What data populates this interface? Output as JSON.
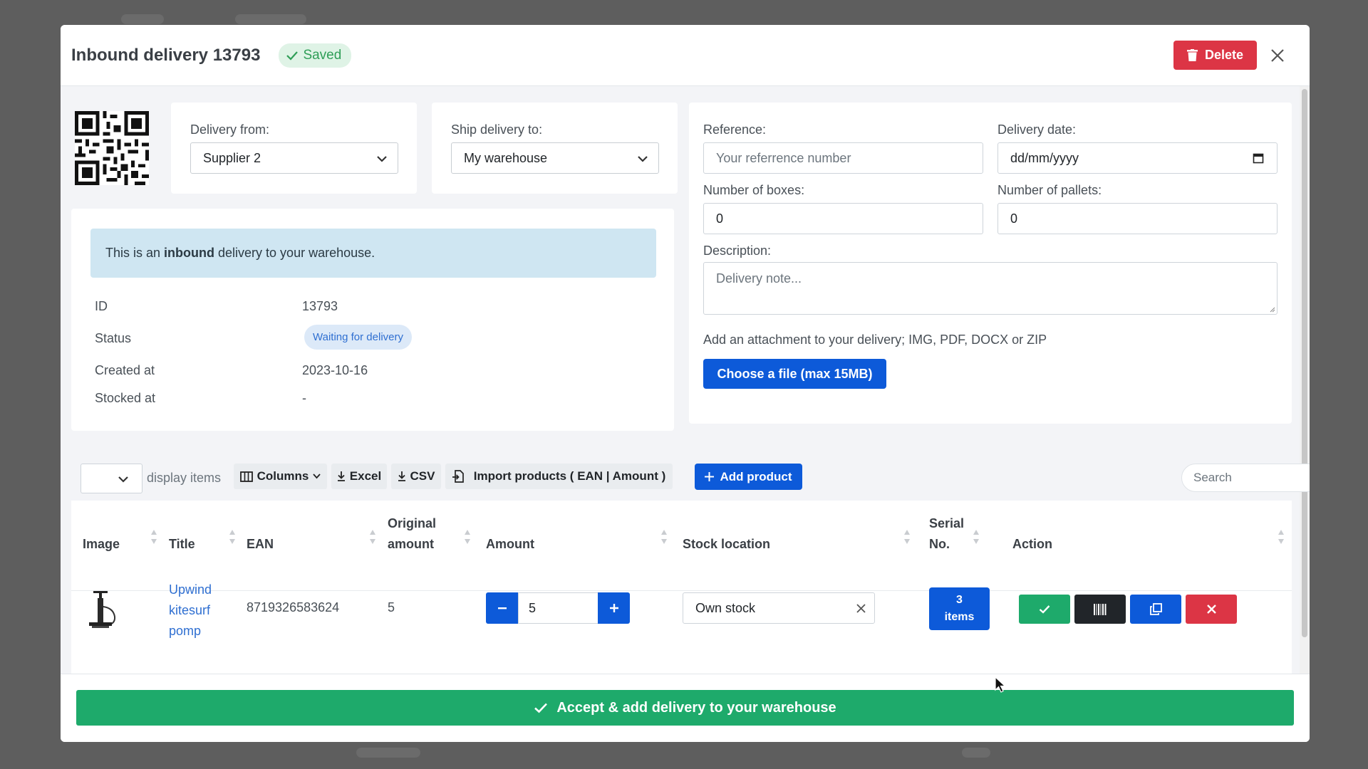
{
  "modal": {
    "title": "Inbound delivery 13793",
    "saved_label": "Saved",
    "delete_label": "Delete"
  },
  "form": {
    "delivery_from_label": "Delivery from:",
    "delivery_from_value": "Supplier 2",
    "ship_to_label": "Ship delivery to:",
    "ship_to_value": "My warehouse",
    "reference_label": "Reference:",
    "reference_placeholder": "Your referrence number",
    "delivery_date_label": "Delivery date:",
    "delivery_date_placeholder": "dd/mm/yyyy",
    "boxes_label": "Number of boxes:",
    "boxes_value": "0",
    "pallets_label": "Number of pallets:",
    "pallets_value": "0",
    "description_label": "Description:",
    "description_placeholder": "Delivery note...",
    "attachment_hint": "Add an attachment to your delivery; IMG, PDF, DOCX or ZIP",
    "choose_file_label": "Choose a file (max 15MB)"
  },
  "info": {
    "alert_prefix": "This is an ",
    "alert_bold": "inbound",
    "alert_suffix": " delivery to your warehouse.",
    "rows": [
      {
        "label": "ID",
        "value": "13793"
      },
      {
        "label": "Status",
        "value": "Waiting for delivery"
      },
      {
        "label": "Created at",
        "value": "2023-10-16"
      },
      {
        "label": "Stocked at",
        "value": "-"
      }
    ]
  },
  "toolbar": {
    "display_items_label": "display items",
    "columns_label": "Columns",
    "excel_label": "Excel",
    "csv_label": "CSV",
    "import_label": "Import products ( EAN | Amount )",
    "add_product_label": "Add product",
    "search_placeholder": "Search"
  },
  "table": {
    "headers": {
      "image": "Image",
      "title": "Title",
      "ean": "EAN",
      "original_amount_1": "Original",
      "original_amount_2": "amount",
      "amount": "Amount",
      "stock_location": "Stock location",
      "serial_1": "Serial",
      "serial_2": "No.",
      "action": "Action"
    },
    "rows": [
      {
        "title_1": "Upwind",
        "title_2": "kitesurf",
        "title_3": "pomp",
        "ean": "8719326583624",
        "original_amount": "5",
        "amount": "5",
        "stock_location": "Own stock",
        "serial_1": "3",
        "serial_2": "items"
      }
    ]
  },
  "footer": {
    "accept_label": "Accept & add delivery to your warehouse"
  },
  "colors": {
    "primary": "#0d5ad9",
    "danger": "#dc3545",
    "success": "#1eaa6b",
    "dark": "#212529",
    "info_bg": "#cfe6f2"
  }
}
